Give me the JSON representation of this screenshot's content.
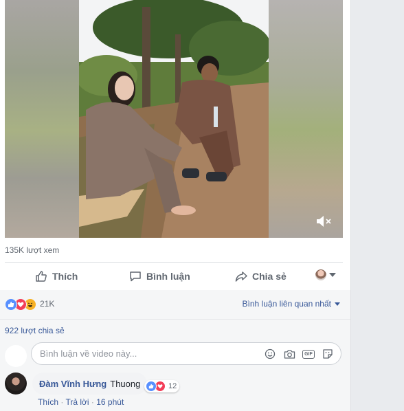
{
  "video": {
    "views": "135K lượt xem"
  },
  "actions": {
    "like": "Thích",
    "comment": "Bình luận",
    "share": "Chia sẻ"
  },
  "reactions": {
    "count": "21K",
    "types": [
      "like",
      "love",
      "haha"
    ]
  },
  "sort": {
    "label": "Bình luận liên quan nhất"
  },
  "shares": {
    "label": "922 lượt chia sẻ"
  },
  "composer": {
    "placeholder": "Bình luận về video này..."
  },
  "comment": {
    "author": "Đàm Vĩnh Hưng",
    "text": "Thuong",
    "reaction_count": "12",
    "like_label": "Thích",
    "reply_label": "Trả lời",
    "time": "16 phút",
    "sep": " · "
  },
  "colors": {
    "link": "#385898",
    "like": "#5890ff",
    "love": "#f33e58",
    "haha": "#f7b125"
  }
}
